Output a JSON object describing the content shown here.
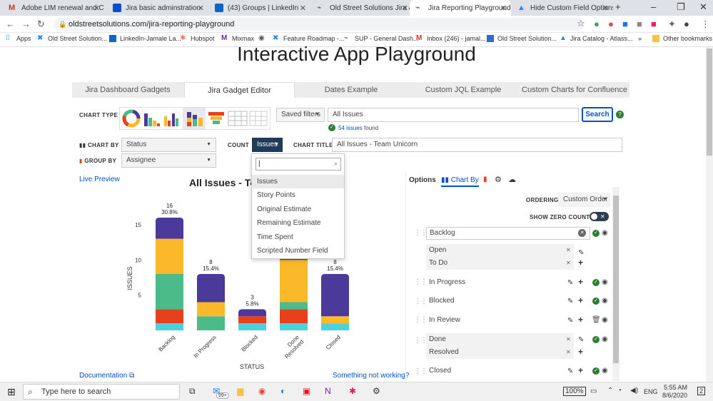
{
  "browser": {
    "tabs": [
      {
        "title": "Adobe LIM renewal and Cust",
        "icon_color": "#d93025"
      },
      {
        "title": "Jira basic adminstration",
        "icon_color": "#0052cc"
      },
      {
        "title": "(43) Groups | LinkedIn",
        "icon_color": "#0a66c2"
      },
      {
        "title": "Old Street Solutions Jira & C",
        "icon_color": "#555555"
      },
      {
        "title": "Jira Reporting Playground",
        "icon_color": "#555555"
      },
      {
        "title": "Hide Custom Field Options",
        "icon_color": "#2684ff"
      }
    ],
    "url": "oldstreetsolutions.com/jira-reporting-playground",
    "bookmarks": [
      "Apps",
      "Old Street Solution...",
      "LinkedIn-Jamale La...",
      "Hubspot",
      "Mixmax",
      "Feature Roadmap -...",
      "SUP - General Dash...",
      "Inbox (246) - jamal...",
      "Old Street Solution...",
      "Jira Catalog - Atlass...",
      "»",
      "Other bookmarks"
    ]
  },
  "page": {
    "title": "Interactive App Playground",
    "tabs": [
      "Jira Dashboard Gadgets",
      "Jira Gadget Editor",
      "Dates Example",
      "Custom JQL Example",
      "Custom Charts for Confluence"
    ]
  },
  "editor": {
    "chart_type_label": "CHART TYPE",
    "saved_filters": "Saved filters",
    "jql_value": "All Issues",
    "search_button": "Search",
    "issues_found_count": "54 issues",
    "issues_found_suffix": "found",
    "chart_by_label": "CHART BY",
    "chart_by_value": "Status",
    "count_label": "COUNT",
    "count_value": "Issues",
    "chart_title_label": "CHART TITLE",
    "chart_title_value": "All Issues - Team Unicorn",
    "group_by_label": "GROUP BY",
    "group_by_value": "Assignee"
  },
  "count_dropdown": {
    "search_value": "",
    "options": [
      "Issues",
      "Story Points",
      "Original Estimate",
      "Remaining Estimate",
      "Time Spent",
      "Scripted Number Field"
    ]
  },
  "preview": {
    "live_preview": "Live Preview",
    "chart_heading": "All Issues - Tea",
    "documentation": "Documentation",
    "something_wrong": "Something not working?"
  },
  "chart_data": {
    "type": "bar",
    "stacked": true,
    "categories": [
      "Backlog",
      "In Progress",
      "Blocked",
      "Done\nResolved",
      "Closed"
    ],
    "totals": [
      16,
      8,
      3,
      null,
      8
    ],
    "total_labels": [
      "16",
      "8",
      "3",
      "",
      "8"
    ],
    "percent_labels": [
      "30.8%",
      "15.4%",
      "5.8%",
      "",
      "15.4%"
    ],
    "series": [
      {
        "values": [
          1,
          0,
          1,
          1,
          1
        ],
        "color": "#4dd0e1"
      },
      {
        "values": [
          2,
          0,
          1,
          2,
          0
        ],
        "color": "#e8401c"
      },
      {
        "values": [
          5,
          2,
          0,
          1,
          0
        ],
        "color": "#4cbb8a"
      },
      {
        "values": [
          5,
          2,
          0,
          6,
          1
        ],
        "color": "#fbb829"
      },
      {
        "values": [
          3,
          4,
          1,
          6,
          6
        ],
        "color": "#4c3a9a"
      }
    ],
    "xlabel": "STATUS",
    "ylabel": "ISSUES",
    "yticks": [
      5,
      10,
      15
    ],
    "ylim": [
      0,
      16
    ]
  },
  "options_panel": {
    "options_tab": "Options",
    "chart_by_tab": "Chart By",
    "ordering_label": "ORDERING",
    "ordering_value": "Custom Order",
    "show_zero_label": "SHOW ZERO COUNTS",
    "groups": {
      "backlog": "Backlog",
      "open": "Open",
      "todo": "To Do",
      "in_progress": "In Progress",
      "blocked": "Blocked",
      "in_review": "In Review",
      "done": "Done",
      "resolved": "Resolved",
      "closed": "Closed"
    }
  },
  "taskbar": {
    "search_placeholder": "Type here to search",
    "badge": "99+",
    "battery": "100%",
    "lang": "ENG",
    "time": "5:55 AM",
    "date": "8/6/2020",
    "notif_count": "2"
  },
  "colors": {
    "accent": "#0052cc",
    "green": "#2e7d32",
    "tab_bg": "#dee1e6"
  }
}
